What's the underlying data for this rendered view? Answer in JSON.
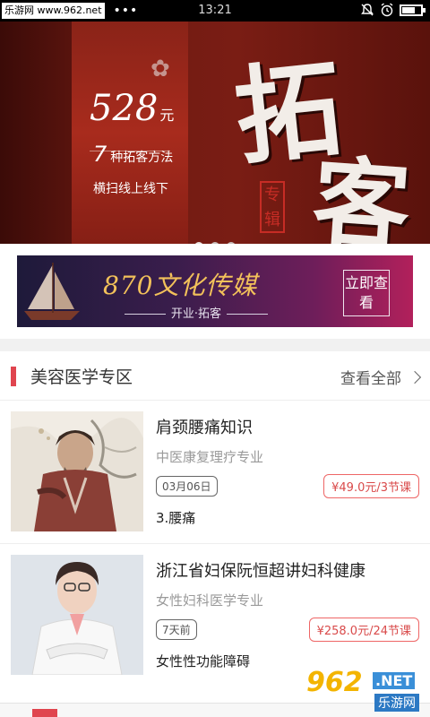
{
  "status_bar": {
    "site_label": "乐游网 www.962.net",
    "dots": "•••",
    "time": "13:21"
  },
  "hero": {
    "price_number": "528",
    "price_unit": "元",
    "count": "7",
    "line1_text": "种拓客方法",
    "line2_text": "横扫线上线下",
    "big_char_1": "拓",
    "big_char_2": "客",
    "stamp_text": "专辑",
    "pages": 3,
    "active_page": 1
  },
  "ad": {
    "title": "870文化传媒",
    "subtitle": "开业·拓客",
    "button_label": "立即查看"
  },
  "section": {
    "title": "美容医学专区",
    "view_all": "查看全部"
  },
  "courses": [
    {
      "title": "肩颈腰痛知识",
      "subtitle": "中医康复理疗专业",
      "date": "03月06日",
      "price": "¥49.0元/3节课",
      "lesson": "3.腰痛"
    },
    {
      "title": "浙江省妇保阮恒超讲妇科健康",
      "subtitle": "女性妇科医学专业",
      "date": "7天前",
      "price": "¥258.0元/24节课",
      "lesson": "女性性功能障碍"
    }
  ],
  "watermark": {
    "number": "962",
    "net": ".NET",
    "text": "乐游网"
  },
  "colors": {
    "accent": "#e0454f",
    "price": "#d94a4a",
    "hero_red": "#7a1d14",
    "ad_gold": "#f2c15a"
  }
}
